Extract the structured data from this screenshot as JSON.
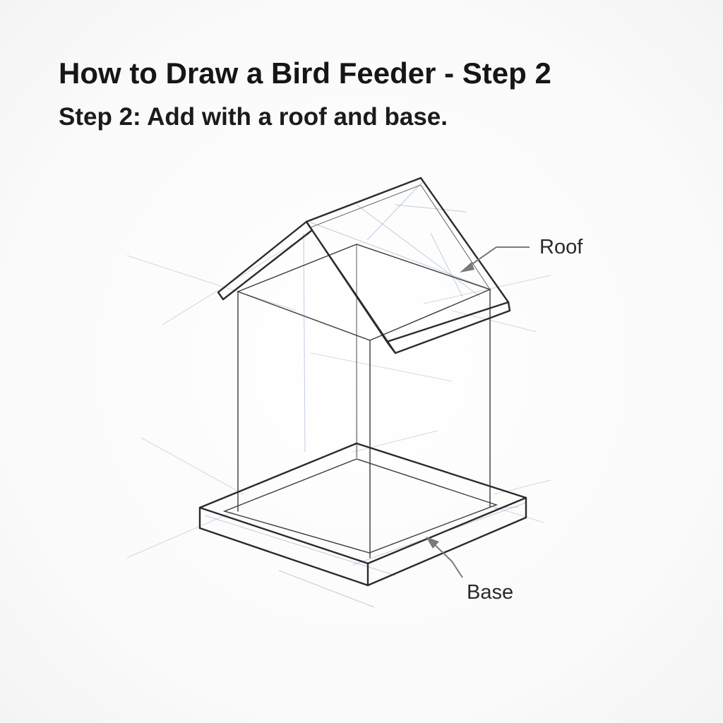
{
  "header": {
    "title": "How to Draw a Bird Feeder - Step 2",
    "subtitle": "Step 2: Add with a roof and base."
  },
  "callouts": {
    "roof_label": "Roof",
    "base_label": "Base"
  },
  "colors": {
    "ink": "#2b2b2b",
    "guide": "#8ea4c8",
    "callout": "#7a7a7a",
    "background": "#fbfbfb"
  }
}
